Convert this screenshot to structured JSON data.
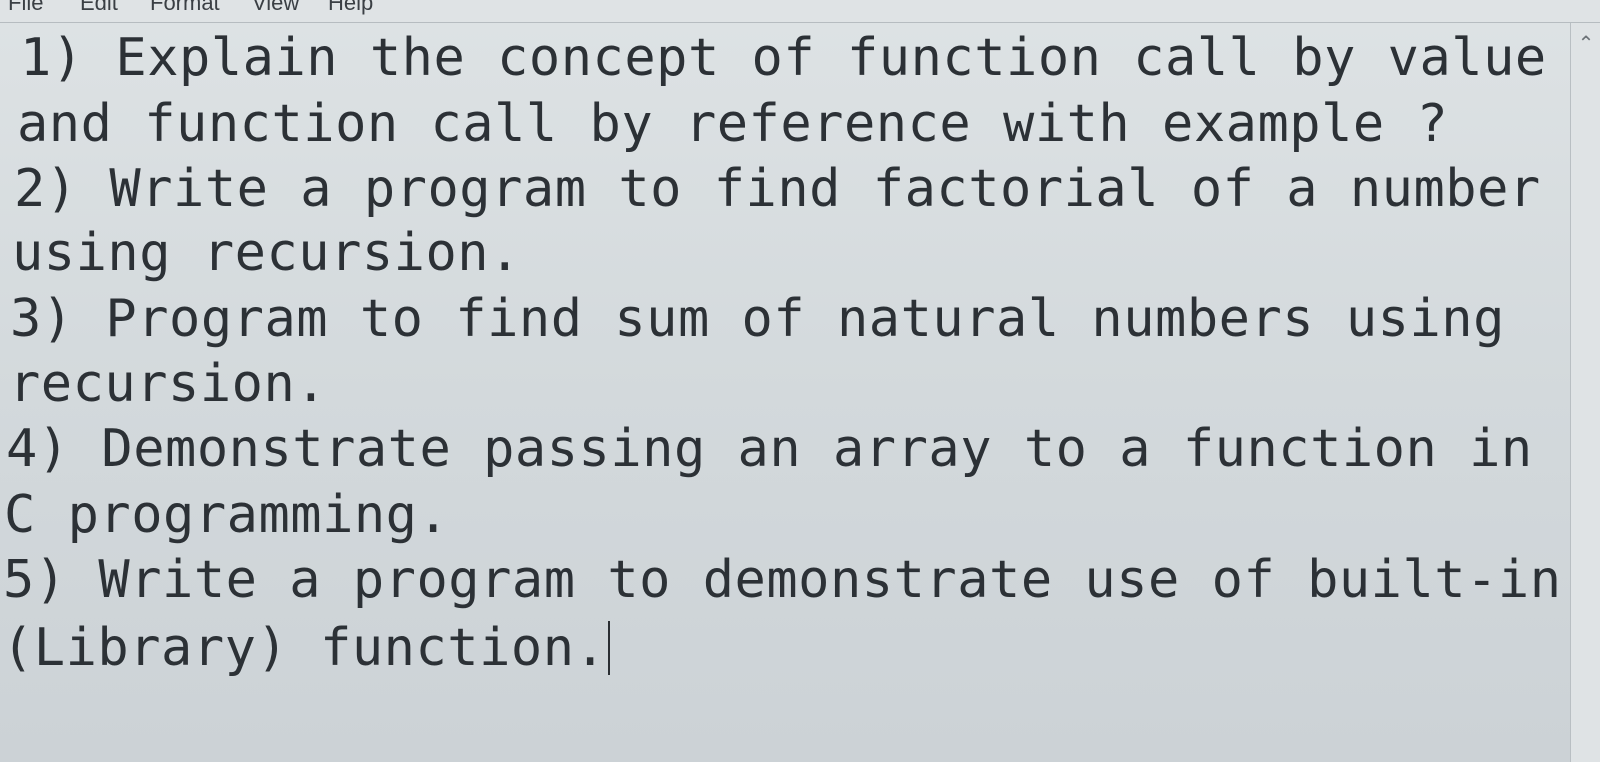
{
  "menubar": {
    "items": [
      "File",
      "Edit",
      "Format",
      "View",
      "Help"
    ]
  },
  "document": {
    "lines": [
      "1) Explain the concept of function call by value",
      "and function call by reference with example ?",
      "2) Write a program to find factorial of a number",
      "using recursion.",
      "3) Program to find sum of natural numbers using",
      "recursion.",
      "4) Demonstrate passing an array to a function in",
      "C programming.",
      "5) Write a program to demonstrate use of built-in",
      "(Library) function."
    ]
  },
  "scrollbar": {
    "up_icon": "chevron-up-icon"
  }
}
